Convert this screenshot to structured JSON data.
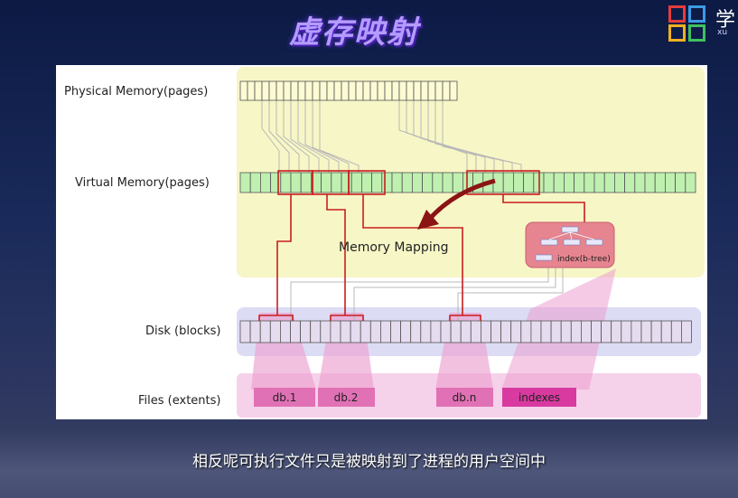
{
  "header": {
    "title": "虚存映射"
  },
  "logo": {
    "text": "学",
    "subtext": "xu"
  },
  "diagram": {
    "row_labels": {
      "physical": "Physical Memory(pages)",
      "virtual": "Virtual Memory(pages)",
      "disk": "Disk (blocks)",
      "files": "Files (extents)"
    },
    "mapping_label": "Memory Mapping",
    "index_label": "index(b-tree)",
    "files": [
      "db.1",
      "db.2",
      "db.n",
      "indexes"
    ],
    "colors": {
      "yellow_zone": "#f7f6c6",
      "physical_cell": "#fdfbd3",
      "virtual_cell": "#bff0b0",
      "disk_zone": "#dcdcf5",
      "disk_cell": "#e6dcf0",
      "files_zone": "#f6d1ea",
      "file_box": "#e171b5",
      "index_box": "#e6848f",
      "mapping_red": "#c81e1e"
    }
  },
  "subtitle": "相反呢可执行文件只是被映射到了进程的用户空间中"
}
